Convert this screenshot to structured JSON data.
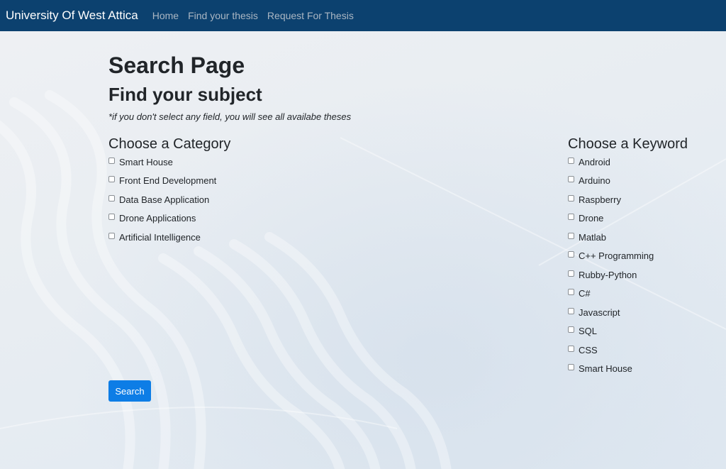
{
  "navbar": {
    "brand": "University Of West Attica",
    "links": [
      "Home",
      "Find your thesis",
      "Request For Thesis"
    ]
  },
  "main": {
    "title": "Search Page",
    "subtitle": "Find your subject",
    "hint": "*if you don't select any field, you will see all availabe theses",
    "category": {
      "title": "Choose a Category",
      "items": [
        "Smart House",
        "Front End Development",
        "Data Base Application",
        "Drone Applications",
        "Artificial Intelligence"
      ]
    },
    "keyword": {
      "title": "Choose a Keyword",
      "items": [
        "Android",
        "Arduino",
        "Raspberry",
        "Drone",
        "Matlab",
        "C++ Programming",
        "Rubby-Python",
        "C#",
        "Javascript",
        "SQL",
        "CSS",
        "Smart House"
      ]
    },
    "search_label": "Search"
  },
  "colors": {
    "navbar": "#0c416f",
    "button": "#0d7de6"
  }
}
